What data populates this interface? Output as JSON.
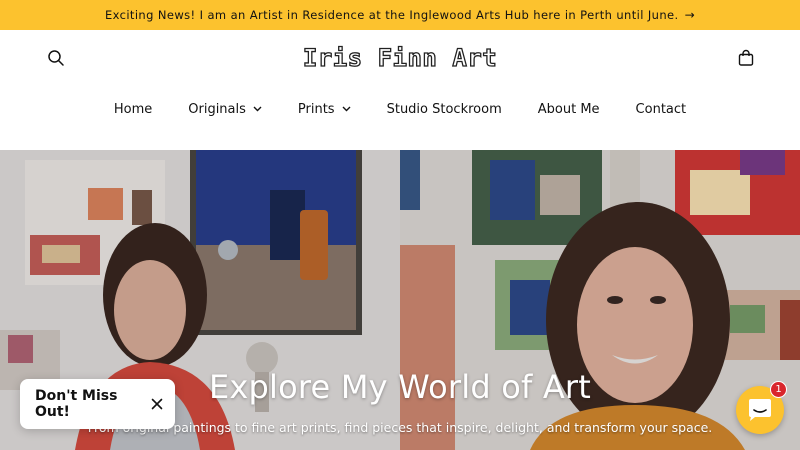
{
  "announcement": {
    "text": "Exciting News! I am an Artist in Residence at the Inglewood Arts Hub here in Perth until June.",
    "arrow": "→"
  },
  "header": {
    "logo": "Iris Finn Art",
    "search_icon": "search-icon",
    "cart_icon": "bag-icon"
  },
  "nav": {
    "items": [
      {
        "label": "Home",
        "has_dropdown": false
      },
      {
        "label": "Originals",
        "has_dropdown": true
      },
      {
        "label": "Prints",
        "has_dropdown": true
      },
      {
        "label": "Studio Stockroom",
        "has_dropdown": false
      },
      {
        "label": "About Me",
        "has_dropdown": false
      },
      {
        "label": "Contact",
        "has_dropdown": false
      }
    ]
  },
  "hero": {
    "title": "Explore My World of Art",
    "subtitle": "From original paintings to fine art prints, find pieces that inspire, delight, and transform your space."
  },
  "popup": {
    "label": "Don't Miss Out!"
  },
  "chat": {
    "badge": "1"
  },
  "colors": {
    "accent": "#fcc22e",
    "badge": "#d9262c",
    "text": "#121212"
  }
}
